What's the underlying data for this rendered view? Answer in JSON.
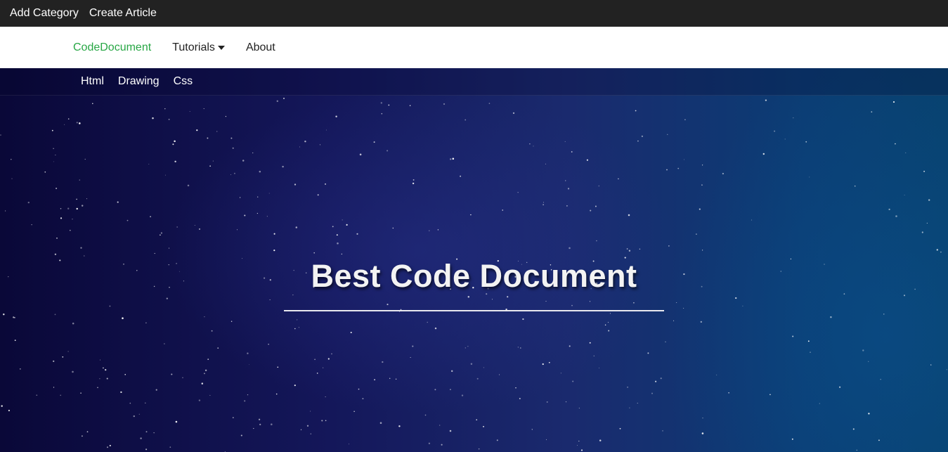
{
  "admin_bar": {
    "add_category": "Add Category",
    "create_article": "Create Article"
  },
  "main_nav": {
    "brand": "CodeDocument",
    "tutorials": "Tutorials",
    "about": "About"
  },
  "sub_nav": {
    "items": [
      "Html",
      "Drawing",
      "Css"
    ]
  },
  "hero": {
    "title": "Best Code Document"
  },
  "colors": {
    "admin_bar_bg": "#222222",
    "brand": "#28a745",
    "hero_dark": "#0a0838",
    "hero_light": "#08426f"
  }
}
